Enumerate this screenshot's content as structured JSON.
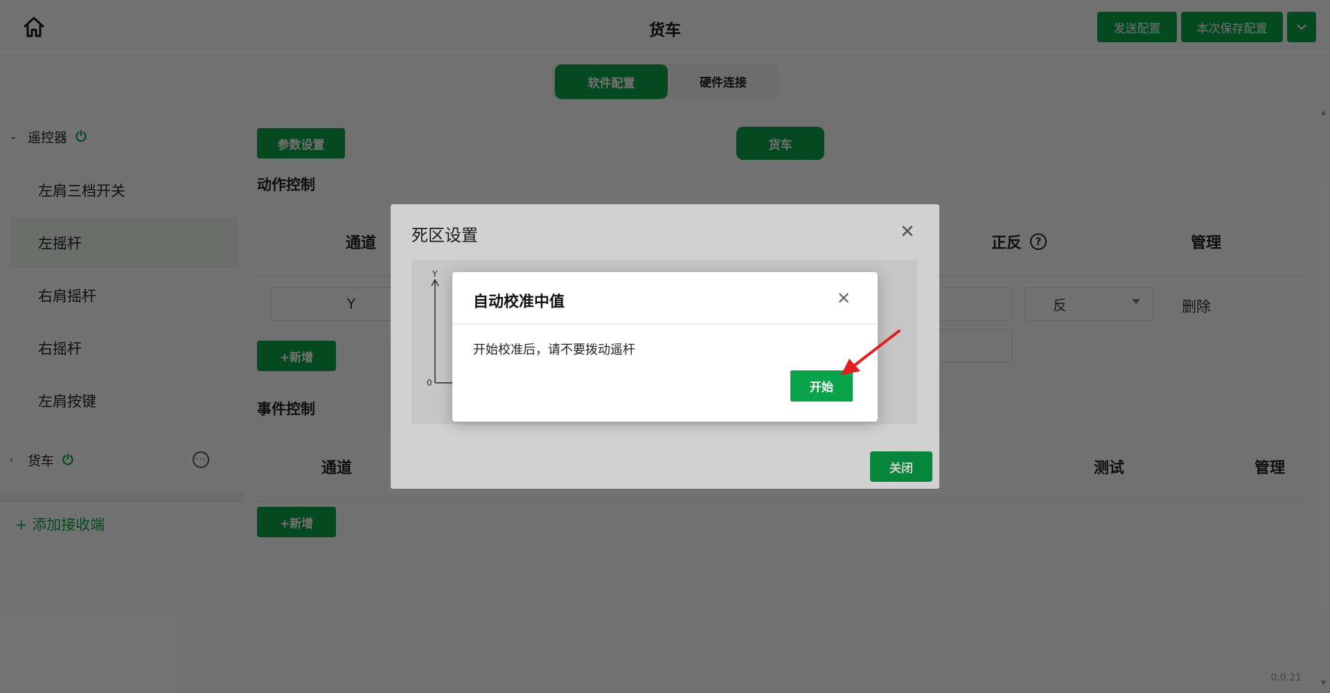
{
  "header": {
    "title": "货车",
    "send_config": "发送配置",
    "save_config": "本次保存配置"
  },
  "mode_tabs": [
    "软件配置",
    "硬件连接"
  ],
  "sidebar": {
    "group1": {
      "label": "遥控器",
      "expanded": true
    },
    "items": [
      "左肩三档开关",
      "左摇杆",
      "右肩摇杆",
      "右摇杆",
      "左肩按键"
    ],
    "selected_item": "左摇杆",
    "group2": {
      "label": "货车",
      "expanded": false
    },
    "add_receiver": "+ 添加接收端"
  },
  "main": {
    "param_button": "参数设置",
    "device_tab": "货车",
    "action_section": {
      "title": "动作控制",
      "headers": [
        "通道",
        "正反",
        "管理"
      ],
      "row": {
        "channel": "Y",
        "direction": "反",
        "delete": "删除"
      },
      "add_button": "+新增"
    },
    "event_section": {
      "title": "事件控制",
      "headers": [
        "通道",
        "测试",
        "管理"
      ],
      "add_button": "+新增"
    },
    "version": "0.0.21"
  },
  "deadzone_dialog": {
    "title": "死区设置",
    "axis_y_label": "Y",
    "axis_origin": "0",
    "close_button": "关闭"
  },
  "calib_dialog": {
    "title": "自动校准中值",
    "message": "开始校准后，请不要拨动遥杆",
    "start_button": "开始"
  },
  "colors": {
    "primary_green": "#0aa34a",
    "annotation_red": "#e02020"
  }
}
